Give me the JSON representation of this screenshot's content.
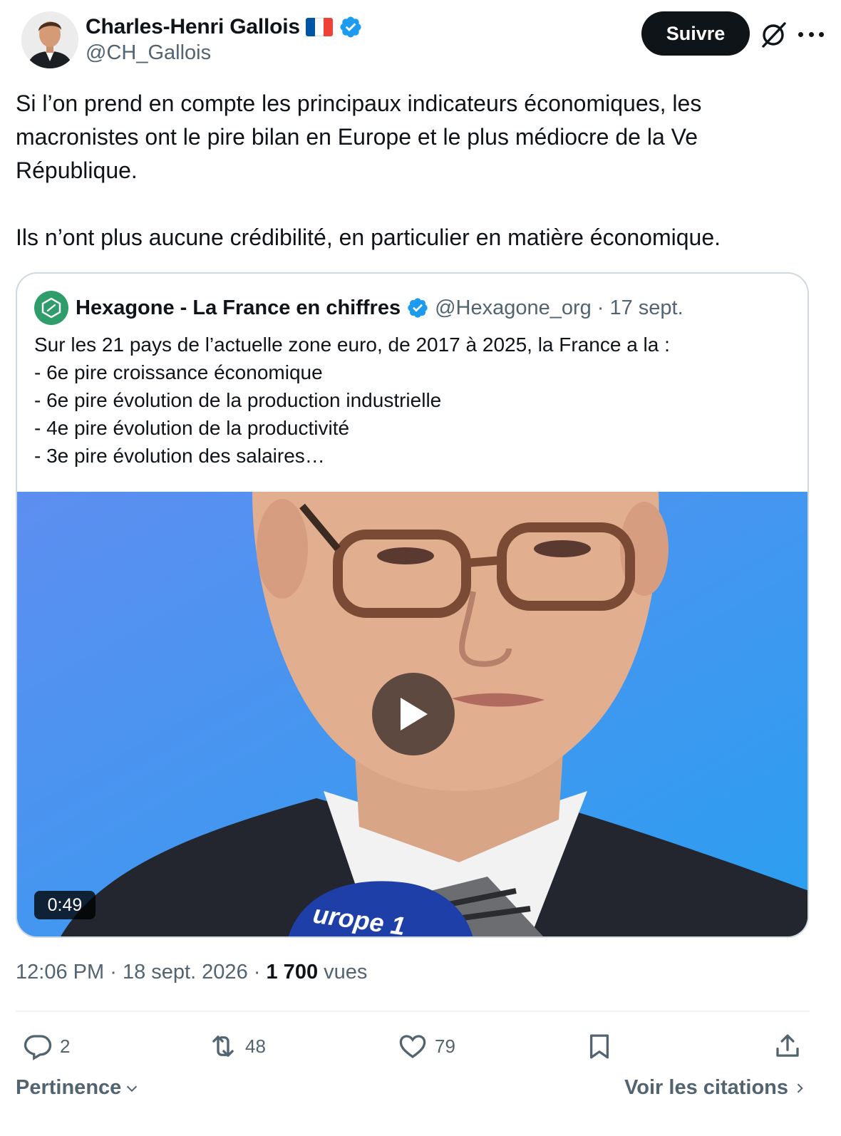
{
  "author": {
    "name": "Charles-Henri Gallois",
    "handle": "@CH_Gallois",
    "flag_colors": [
      "#0055a4",
      "#ffffff",
      "#ef4135"
    ],
    "verified_color": "#1d9bf0"
  },
  "follow_label": "Suivre",
  "tweet_text": "Si l’on prend en compte les principaux indicateurs économiques, les macronistes ont le pire bilan en Europe et le plus médiocre de la Ve République.\n\nIls n’ont plus aucune crédibilité, en particulier en matière économique.",
  "quote": {
    "name": "Hexagone - La France en chiffres",
    "handle": "@Hexagone_org",
    "separator": "·",
    "date": "17 sept.",
    "text": "Sur les 21 pays de l’actuelle zone euro, de 2017 à 2025, la France a la :\n- 6e pire croissance économique\n- 6e pire évolution de la production industrielle\n- 4e pire évolution de la productivité\n- 3e pire évolution des salaires…",
    "video_duration": "0:49",
    "video_mic_text": "urope 1"
  },
  "meta": {
    "time": "12:06 PM",
    "separator": "·",
    "date": "18 sept. 2026",
    "views_count": "1 700",
    "views_label": "vues"
  },
  "actions": {
    "replies": "2",
    "reposts": "48",
    "likes": "79"
  },
  "footer": {
    "sort_label": "Pertinence",
    "quotes_link": "Voir les citations"
  },
  "icons": [
    "verified-badge-icon",
    "grok-icon",
    "more-icon",
    "play-icon",
    "reply-icon",
    "repost-icon",
    "like-icon",
    "bookmark-icon",
    "share-icon",
    "chevron-down-icon",
    "chevron-right-icon"
  ]
}
